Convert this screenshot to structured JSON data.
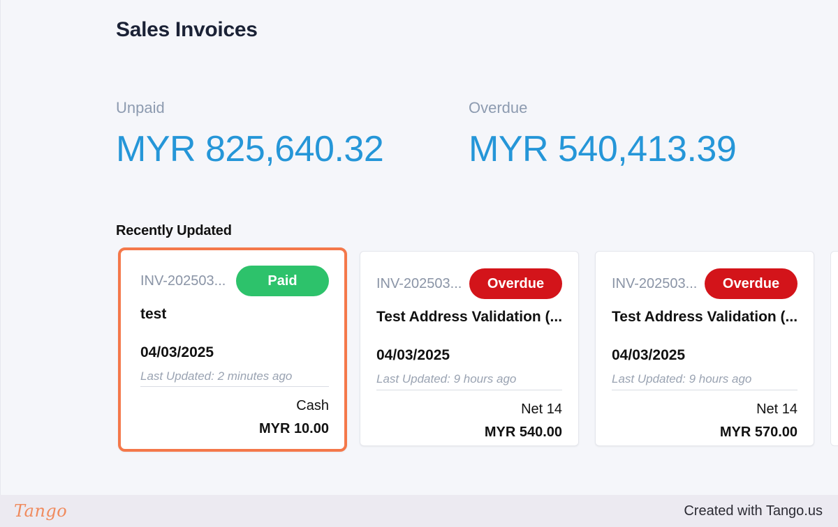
{
  "page": {
    "title": "Sales Invoices"
  },
  "summary": {
    "unpaid": {
      "label": "Unpaid",
      "value": "MYR 825,640.32"
    },
    "overdue": {
      "label": "Overdue",
      "value": "MYR 540,413.39"
    }
  },
  "recent": {
    "title": "Recently Updated",
    "cards": [
      {
        "invoice": "INV-202503...",
        "status": "Paid",
        "status_color": "#2dc26b",
        "name": "test",
        "date": "04/03/2025",
        "updated": "Last Updated: 2 minutes ago",
        "terms": "Cash",
        "amount": "MYR 10.00"
      },
      {
        "invoice": "INV-202503...",
        "status": "Overdue",
        "status_color": "#d3141a",
        "name": "Test Address Validation (...",
        "date": "04/03/2025",
        "updated": "Last Updated: 9 hours ago",
        "terms": "Net 14",
        "amount": "MYR 540.00"
      },
      {
        "invoice": "INV-202503...",
        "status": "Overdue",
        "status_color": "#d3141a",
        "name": "Test Address Validation (...",
        "date": "04/03/2025",
        "updated": "Last Updated: 9 hours ago",
        "terms": "Net 14",
        "amount": "MYR 570.00"
      }
    ]
  },
  "colors": {
    "highlight": "#f4784a",
    "accent": "#2596d8"
  },
  "footer": {
    "logo": "Tango",
    "text": "Created with Tango.us"
  }
}
